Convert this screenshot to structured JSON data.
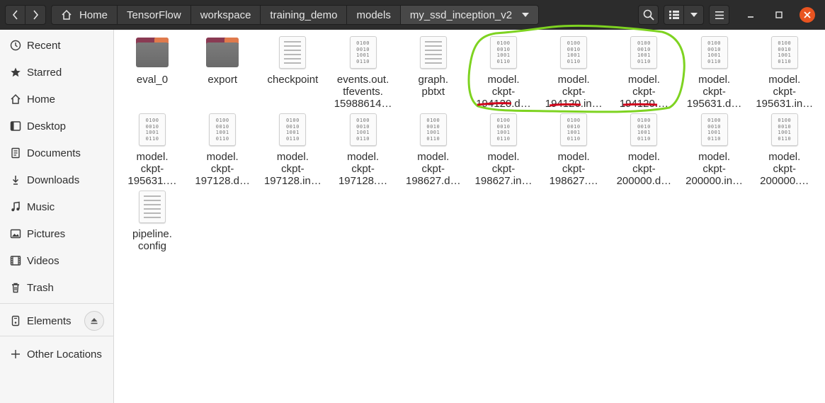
{
  "header": {
    "breadcrumbs": [
      "Home",
      "TensorFlow",
      "workspace",
      "training_demo",
      "models",
      "my_ssd_inception_v2"
    ],
    "icons": {
      "back": "chevron-left-icon",
      "forward": "chevron-right-icon",
      "home": "home-icon",
      "search": "search-icon",
      "view": "list-view-icon",
      "menu": "hamburger-menu-icon",
      "close": "close-icon"
    },
    "colors": {
      "bar": "#2c2c2c",
      "close": "#e95420"
    }
  },
  "sidebar": {
    "items": [
      {
        "label": "Recent",
        "icon": "clock-icon"
      },
      {
        "label": "Starred",
        "icon": "star-icon"
      },
      {
        "label": "Home",
        "icon": "home-icon"
      },
      {
        "label": "Desktop",
        "icon": "desktop-icon"
      },
      {
        "label": "Documents",
        "icon": "documents-icon"
      },
      {
        "label": "Downloads",
        "icon": "download-icon"
      },
      {
        "label": "Music",
        "icon": "music-icon"
      },
      {
        "label": "Pictures",
        "icon": "pictures-icon"
      },
      {
        "label": "Videos",
        "icon": "videos-icon"
      },
      {
        "label": "Trash",
        "icon": "trash-icon"
      },
      {
        "label": "Elements",
        "icon": "usb-drive-icon"
      },
      {
        "label": "Other Locations",
        "icon": "plus-icon"
      }
    ]
  },
  "files": [
    {
      "name": "eval_0",
      "type": "folder"
    },
    {
      "name": "export",
      "type": "folder"
    },
    {
      "name": "checkpoint",
      "type": "text"
    },
    {
      "name": "events.out.\ntfevents.\n15988614…",
      "type": "binary"
    },
    {
      "name": "graph.\npbtxt",
      "type": "text"
    },
    {
      "name": "model.\nckpt-\n194120.d…",
      "type": "binary"
    },
    {
      "name": "model.\nckpt-\n194120.in…",
      "type": "binary"
    },
    {
      "name": "model.\nckpt-\n194120.…",
      "type": "binary"
    },
    {
      "name": "model.\nckpt-\n195631.d…",
      "type": "binary"
    },
    {
      "name": "model.\nckpt-\n195631.in…",
      "type": "binary"
    },
    {
      "name": "model.\nckpt-\n195631.…",
      "type": "binary"
    },
    {
      "name": "model.\nckpt-\n197128.d…",
      "type": "binary"
    },
    {
      "name": "model.\nckpt-\n197128.in…",
      "type": "binary"
    },
    {
      "name": "model.\nckpt-\n197128.…",
      "type": "binary"
    },
    {
      "name": "model.\nckpt-\n198627.d…",
      "type": "binary"
    },
    {
      "name": "model.\nckpt-\n198627.in…",
      "type": "binary"
    },
    {
      "name": "model.\nckpt-\n198627.…",
      "type": "binary"
    },
    {
      "name": "model.\nckpt-\n200000.d…",
      "type": "binary"
    },
    {
      "name": "model.\nckpt-\n200000.in…",
      "type": "binary"
    },
    {
      "name": "model.\nckpt-\n200000.…",
      "type": "binary"
    },
    {
      "name": "pipeline.\nconfig",
      "type": "text"
    }
  ],
  "binary_glyph": [
    "0100",
    "0010",
    "1001",
    "0110"
  ],
  "annotation": {
    "outline_color": "#7ed321",
    "underline_color": "#d0021b"
  }
}
